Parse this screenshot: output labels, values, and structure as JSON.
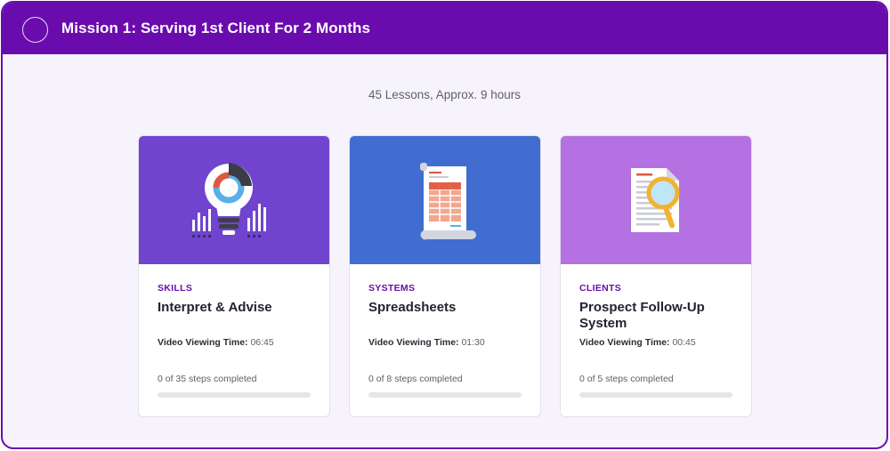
{
  "mission": {
    "title": "Mission 1: Serving 1st Client For 2 Months",
    "summary": "45 Lessons, Approx. 9 hours"
  },
  "cards": [
    {
      "category": "SKILLS",
      "title": "Interpret & Advise",
      "time_label": "Video Viewing Time:",
      "time_value": "06:45",
      "steps": "0 of 35 steps completed",
      "progress": 0,
      "bg_color": "#7044cf",
      "icon": "lightbulb-chart-icon"
    },
    {
      "category": "SYSTEMS",
      "title": "Spreadsheets",
      "time_label": "Video Viewing Time:",
      "time_value": "01:30",
      "steps": "0 of 8 steps completed",
      "progress": 0,
      "bg_color": "#416dd1",
      "icon": "spreadsheet-scroll-icon"
    },
    {
      "category": "CLIENTS",
      "title": "Prospect Follow-Up System",
      "time_label": "Video Viewing Time:",
      "time_value": "00:45",
      "steps": "0 of 5 steps completed",
      "progress": 0,
      "bg_color": "#b371e1",
      "icon": "document-magnifier-icon"
    }
  ],
  "colors": {
    "accent": "#6a0cad",
    "panel_bg": "#f7f3fd"
  }
}
